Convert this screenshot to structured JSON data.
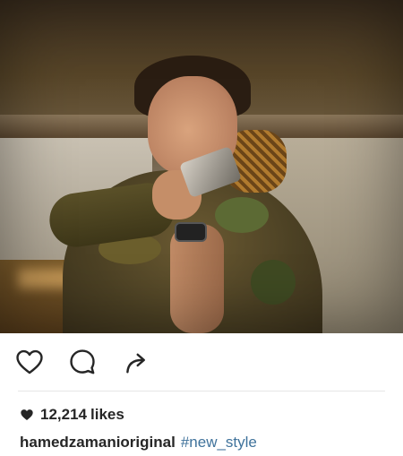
{
  "post": {
    "likes_count": "12,214",
    "likes_label": "likes",
    "username": "hamedzamanioriginal",
    "hashtag": "#new_style"
  },
  "icons": {
    "like": "heart-outline-icon",
    "comment": "comment-bubble-icon",
    "share": "share-arrow-icon",
    "likes_marker": "heart-filled-icon"
  },
  "colors": {
    "text": "#262626",
    "hashtag": "#3f729b",
    "divider": "#e6e6e6"
  }
}
